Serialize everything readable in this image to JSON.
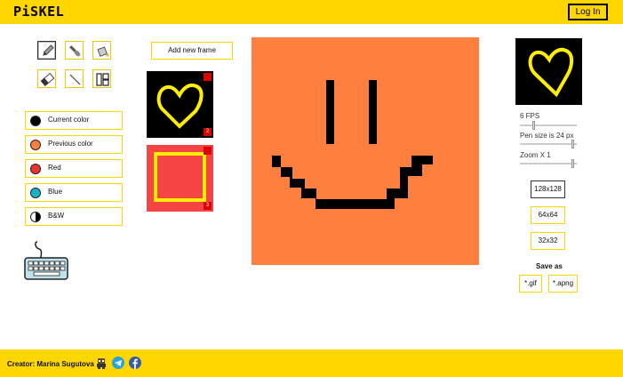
{
  "header": {
    "logo": "PiSKEL",
    "login_label": "Log In"
  },
  "tools": [
    {
      "icon": "pencil-icon",
      "active": true
    },
    {
      "icon": "brush-icon",
      "active": false
    },
    {
      "icon": "paint-bucket-icon",
      "active": false
    },
    {
      "icon": "eraser-icon",
      "active": false
    },
    {
      "icon": "line-icon",
      "active": false
    },
    {
      "icon": "layout-icon",
      "active": false
    }
  ],
  "palette": [
    {
      "label": "Current color",
      "color": "#000000"
    },
    {
      "label": "Previous color",
      "color": "#ff7f3f"
    },
    {
      "label": "Red",
      "color": "#ee3333"
    },
    {
      "label": "Blue",
      "color": "#16b3c8"
    },
    {
      "label": "B&W",
      "color": "half"
    }
  ],
  "frames": {
    "add_label": "Add new frame",
    "items": [
      {
        "number": "2"
      },
      {
        "number": "3"
      }
    ]
  },
  "sidebar": {
    "fps_label": "6 FPS",
    "fps_value": 6,
    "pen_label": "Pen size is 24 px",
    "zoom_label": "Zoom X 1",
    "sizes": [
      "128x128",
      "64x64",
      "32x32"
    ],
    "selected_size": "128x128",
    "save_label": "Save as",
    "save_gif": "*.gif",
    "save_apng": "*.apng"
  },
  "footer": {
    "creator": "Creator: Marina Sugutova"
  },
  "colors": {
    "accent": "#ffd600",
    "canvas": "#ff7f3f",
    "heart": "#ffee00",
    "frame_red": "#f44444",
    "badge": "#e00000"
  }
}
